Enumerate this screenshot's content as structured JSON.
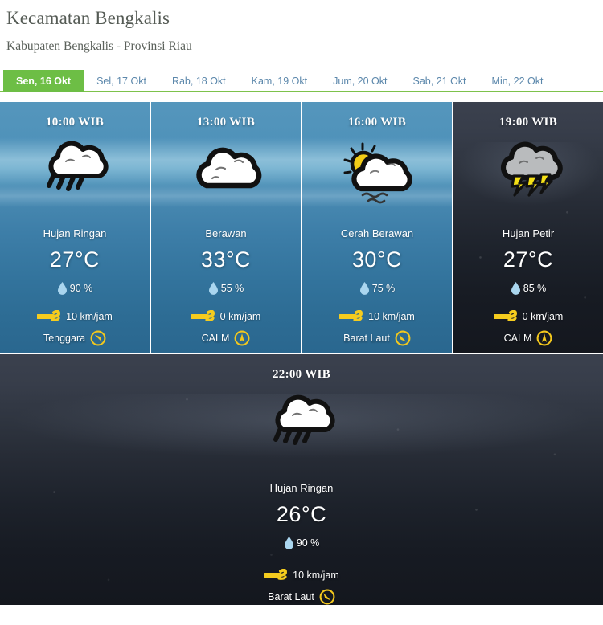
{
  "header": {
    "title": "Kecamatan Bengkalis",
    "subtitle": "Kabupaten Bengkalis - Provinsi Riau"
  },
  "tabs": {
    "active_index": 0,
    "items": [
      {
        "label": "Sen, 16 Okt"
      },
      {
        "label": "Sel, 17 Okt"
      },
      {
        "label": "Rab, 18 Okt"
      },
      {
        "label": "Kam, 19 Okt"
      },
      {
        "label": "Jum, 20 Okt"
      },
      {
        "label": "Sab, 21 Okt"
      },
      {
        "label": "Min, 22 Okt"
      }
    ]
  },
  "forecast": [
    {
      "time": "10:00 WIB",
      "icon": "rain-cloud-icon",
      "condition": "Hujan Ringan",
      "temperature": "27°C",
      "humidity": "90 %",
      "wind_speed": "10 km/jam",
      "wind_direction": "Tenggara",
      "period": "day"
    },
    {
      "time": "13:00 WIB",
      "icon": "cloud-icon",
      "condition": "Berawan",
      "temperature": "33°C",
      "humidity": "55 %",
      "wind_speed": "0 km/jam",
      "wind_direction": "CALM",
      "period": "day"
    },
    {
      "time": "16:00 WIB",
      "icon": "sun-behind-cloud-icon",
      "condition": "Cerah Berawan",
      "temperature": "30°C",
      "humidity": "75 %",
      "wind_speed": "10 km/jam",
      "wind_direction": "Barat Laut",
      "period": "day"
    },
    {
      "time": "19:00 WIB",
      "icon": "thunderstorm-icon",
      "condition": "Hujan Petir",
      "temperature": "27°C",
      "humidity": "85 %",
      "wind_speed": "0 km/jam",
      "wind_direction": "CALM",
      "period": "night"
    },
    {
      "time": "22:00 WIB",
      "icon": "rain-cloud-icon",
      "condition": "Hujan Ringan",
      "temperature": "26°C",
      "humidity": "90 %",
      "wind_speed": "10 km/jam",
      "wind_direction": "Barat Laut",
      "period": "night"
    }
  ],
  "colors": {
    "accent_green": "#6dbe45",
    "tab_inactive_text": "#5b87ab",
    "wind_icon_yellow": "#f5cc1e",
    "humidity_droplet_blue": "#aad6ef",
    "compass_yellow": "#f3c81d"
  }
}
